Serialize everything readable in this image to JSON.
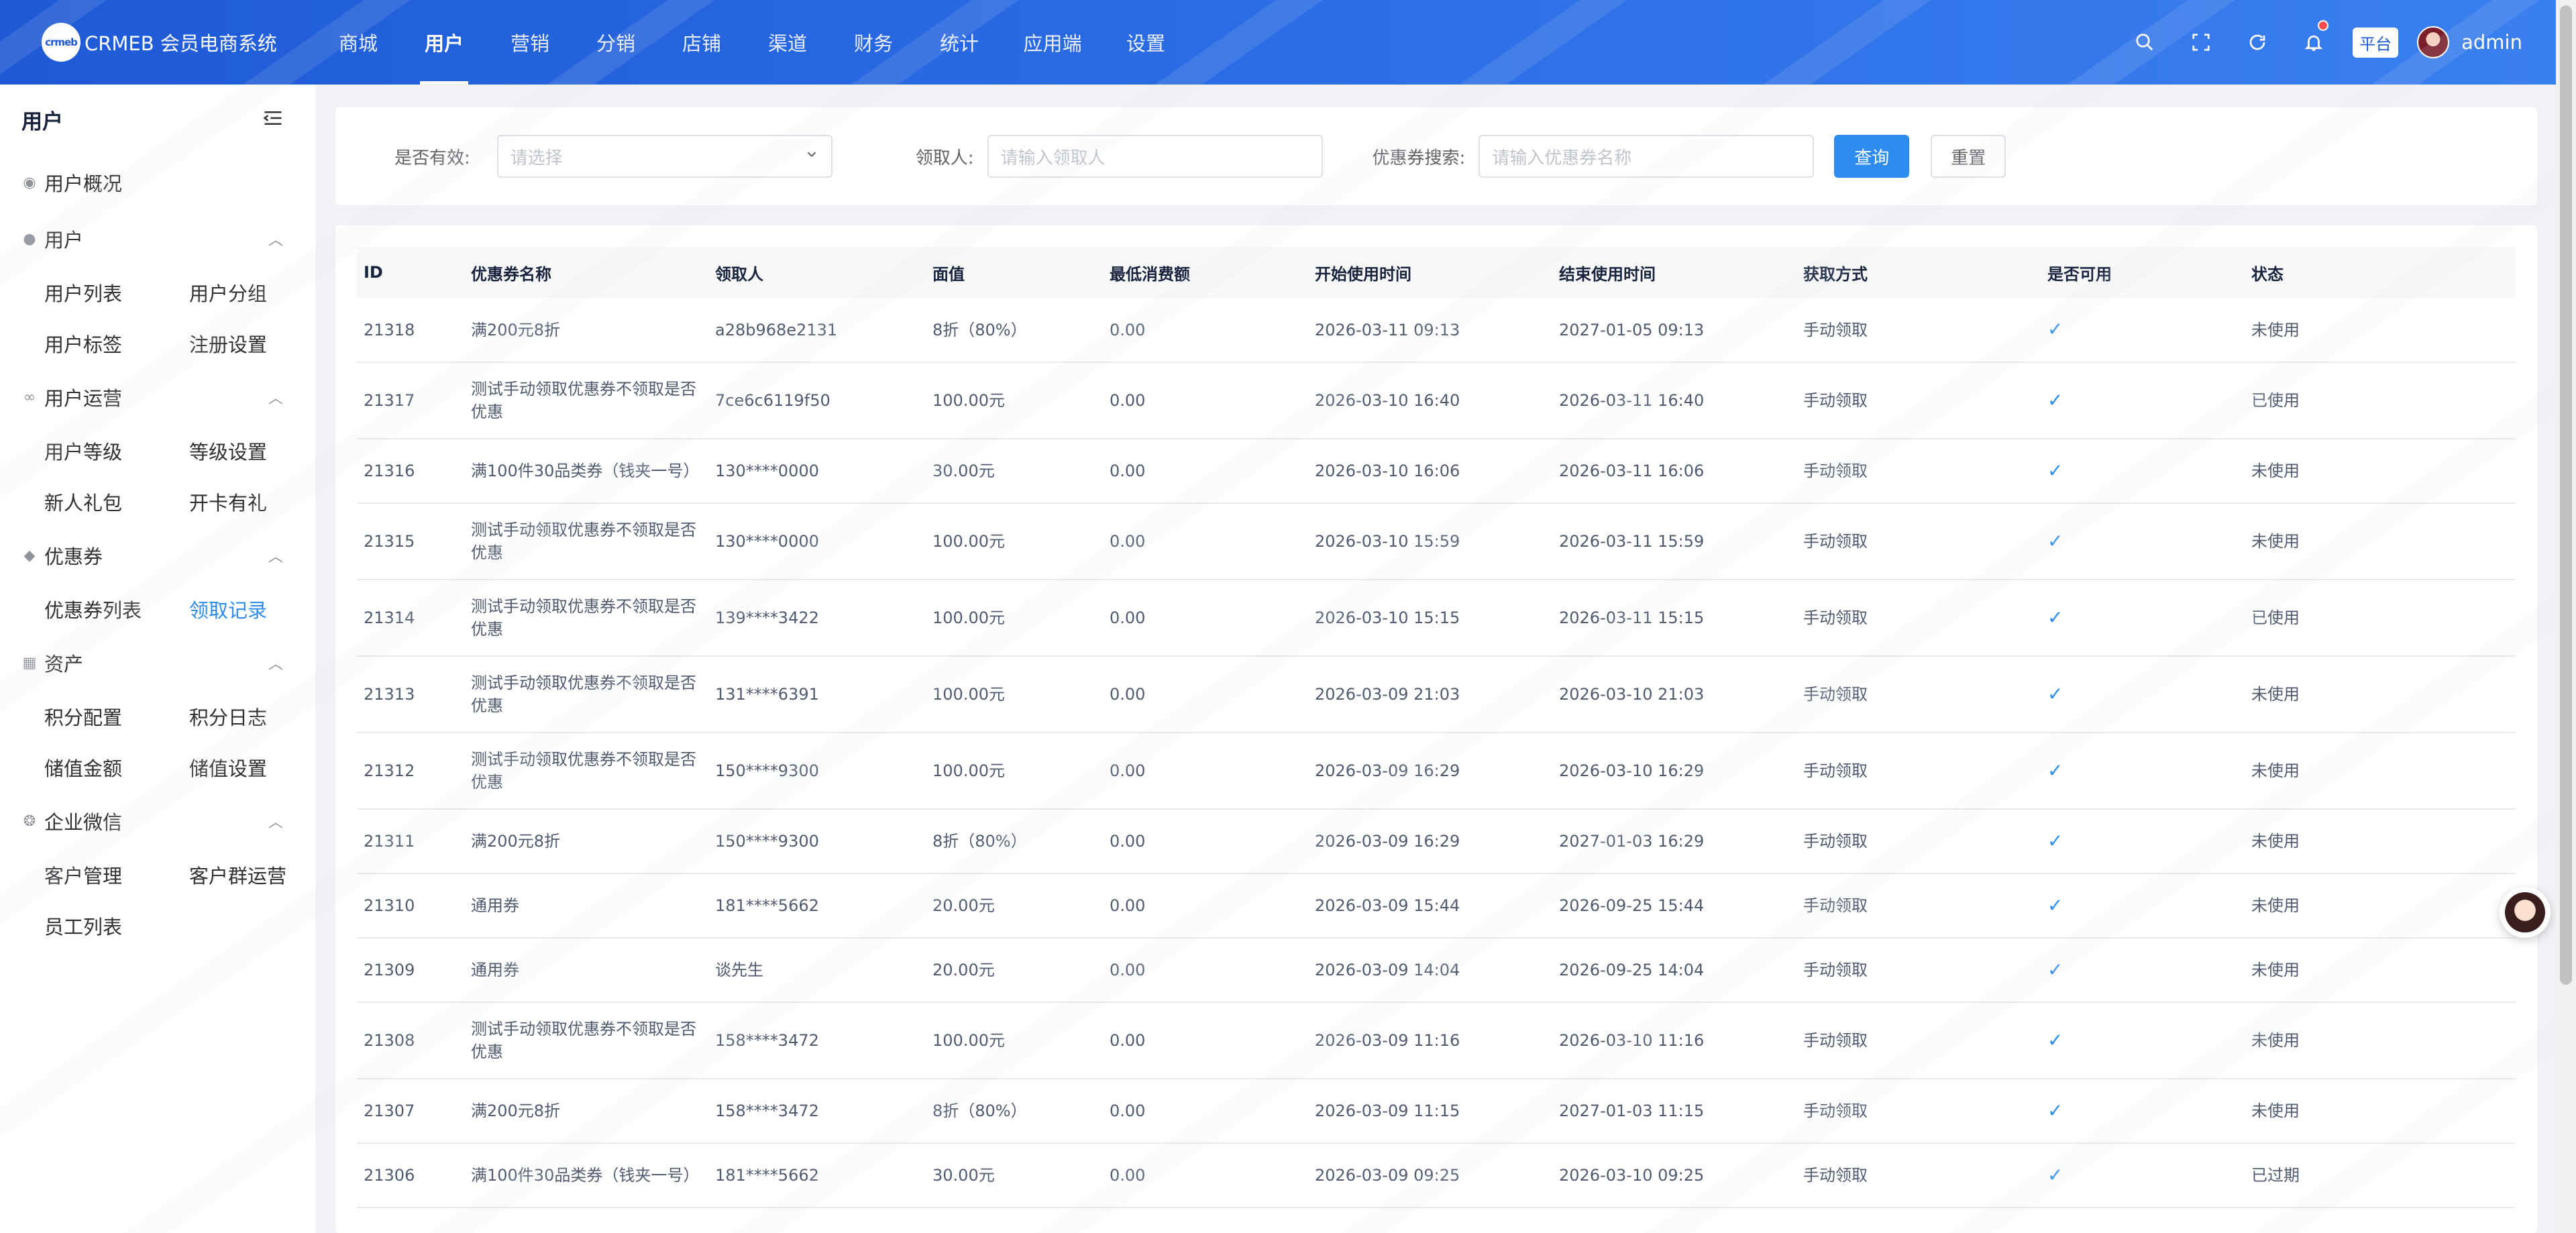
{
  "brand": {
    "logo_text": "crmeb",
    "name": "CRMEB 会员电商系统"
  },
  "nav": [
    {
      "label": "商城",
      "active": false
    },
    {
      "label": "用户",
      "active": true
    },
    {
      "label": "营销",
      "active": false
    },
    {
      "label": "分销",
      "active": false
    },
    {
      "label": "店铺",
      "active": false
    },
    {
      "label": "渠道",
      "active": false
    },
    {
      "label": "财务",
      "active": false
    },
    {
      "label": "统计",
      "active": false
    },
    {
      "label": "应用端",
      "active": false
    },
    {
      "label": "设置",
      "active": false
    }
  ],
  "topbar": {
    "platform_badge": "平台",
    "username": "admin"
  },
  "sidebar": {
    "title": "用户",
    "overview": "用户概况",
    "groups": [
      {
        "title": "用户",
        "icon": "user-icon",
        "items": [
          "用户列表",
          "用户分组",
          "用户标签",
          "注册设置"
        ]
      },
      {
        "title": "用户运营",
        "icon": "link-icon",
        "items": [
          "用户等级",
          "等级设置",
          "新人礼包",
          "开卡有礼"
        ]
      },
      {
        "title": "优惠券",
        "icon": "coupon-icon",
        "items": [
          "优惠券列表",
          "领取记录"
        ]
      },
      {
        "title": "资产",
        "icon": "wallet-icon",
        "items": [
          "积分配置",
          "积分日志",
          "储值金额",
          "储值设置"
        ]
      },
      {
        "title": "企业微信",
        "icon": "wechat-icon",
        "items": [
          "客户管理",
          "客户群运营",
          "员工列表"
        ]
      }
    ],
    "active_item": "领取记录"
  },
  "filters": {
    "valid_label": "是否有效:",
    "valid_placeholder": "请选择",
    "claimer_label": "领取人:",
    "claimer_placeholder": "请输入领取人",
    "search_label": "优惠券搜索:",
    "search_placeholder": "请输入优惠券名称",
    "query_button": "查询",
    "reset_button": "重置"
  },
  "table": {
    "headers": [
      "ID",
      "优惠券名称",
      "领取人",
      "面值",
      "最低消费额",
      "开始使用时间",
      "结束使用时间",
      "获取方式",
      "是否可用",
      "状态"
    ],
    "rows": [
      {
        "id": "21318",
        "name": "满200元8折",
        "user": "a28b968e2131",
        "value": "8折（80%）",
        "min": "0.00",
        "start": "2026-03-11 09:13",
        "end": "2027-01-05 09:13",
        "method": "手动领取",
        "usable": true,
        "status": "未使用",
        "tall": false
      },
      {
        "id": "21317",
        "name": "测试手动领取优惠券不领取是否优惠",
        "user": "7ce6c6119f50",
        "value": "100.00元",
        "min": "0.00",
        "start": "2026-03-10 16:40",
        "end": "2026-03-11 16:40",
        "method": "手动领取",
        "usable": true,
        "status": "已使用",
        "tall": true
      },
      {
        "id": "21316",
        "name": "满100件30品类券（钱夹一号）",
        "user": "130****0000",
        "value": "30.00元",
        "min": "0.00",
        "start": "2026-03-10 16:06",
        "end": "2026-03-11 16:06",
        "method": "手动领取",
        "usable": true,
        "status": "未使用",
        "tall": false
      },
      {
        "id": "21315",
        "name": "测试手动领取优惠券不领取是否优惠",
        "user": "130****0000",
        "value": "100.00元",
        "min": "0.00",
        "start": "2026-03-10 15:59",
        "end": "2026-03-11 15:59",
        "method": "手动领取",
        "usable": true,
        "status": "未使用",
        "tall": true
      },
      {
        "id": "21314",
        "name": "测试手动领取优惠券不领取是否优惠",
        "user": "139****3422",
        "value": "100.00元",
        "min": "0.00",
        "start": "2026-03-10 15:15",
        "end": "2026-03-11 15:15",
        "method": "手动领取",
        "usable": true,
        "status": "已使用",
        "tall": true
      },
      {
        "id": "21313",
        "name": "测试手动领取优惠券不领取是否优惠",
        "user": "131****6391",
        "value": "100.00元",
        "min": "0.00",
        "start": "2026-03-09 21:03",
        "end": "2026-03-10 21:03",
        "method": "手动领取",
        "usable": true,
        "status": "未使用",
        "tall": true
      },
      {
        "id": "21312",
        "name": "测试手动领取优惠券不领取是否优惠",
        "user": "150****9300",
        "value": "100.00元",
        "min": "0.00",
        "start": "2026-03-09 16:29",
        "end": "2026-03-10 16:29",
        "method": "手动领取",
        "usable": true,
        "status": "未使用",
        "tall": true
      },
      {
        "id": "21311",
        "name": "满200元8折",
        "user": "150****9300",
        "value": "8折（80%）",
        "min": "0.00",
        "start": "2026-03-09 16:29",
        "end": "2027-01-03 16:29",
        "method": "手动领取",
        "usable": true,
        "status": "未使用",
        "tall": false
      },
      {
        "id": "21310",
        "name": "通用券",
        "user": "181****5662",
        "value": "20.00元",
        "min": "0.00",
        "start": "2026-03-09 15:44",
        "end": "2026-09-25 15:44",
        "method": "手动领取",
        "usable": true,
        "status": "未使用",
        "tall": false
      },
      {
        "id": "21309",
        "name": "通用券",
        "user": "谈先生",
        "value": "20.00元",
        "min": "0.00",
        "start": "2026-03-09 14:04",
        "end": "2026-09-25 14:04",
        "method": "手动领取",
        "usable": true,
        "status": "未使用",
        "tall": false
      },
      {
        "id": "21308",
        "name": "测试手动领取优惠券不领取是否优惠",
        "user": "158****3472",
        "value": "100.00元",
        "min": "0.00",
        "start": "2026-03-09 11:16",
        "end": "2026-03-10 11:16",
        "method": "手动领取",
        "usable": true,
        "status": "未使用",
        "tall": true
      },
      {
        "id": "21307",
        "name": "满200元8折",
        "user": "158****3472",
        "value": "8折（80%）",
        "min": "0.00",
        "start": "2026-03-09 11:15",
        "end": "2027-01-03 11:15",
        "method": "手动领取",
        "usable": true,
        "status": "未使用",
        "tall": false
      },
      {
        "id": "21306",
        "name": "满100件30品类券（钱夹一号）",
        "user": "181****5662",
        "value": "30.00元",
        "min": "0.00",
        "start": "2026-03-09 09:25",
        "end": "2026-03-10 09:25",
        "method": "手动领取",
        "usable": true,
        "status": "已过期",
        "tall": false
      }
    ]
  },
  "colors": {
    "primary": "#2d8cf0",
    "nav_gradient_start": "#1f5ad6",
    "nav_gradient_end": "#3a7ff0"
  }
}
